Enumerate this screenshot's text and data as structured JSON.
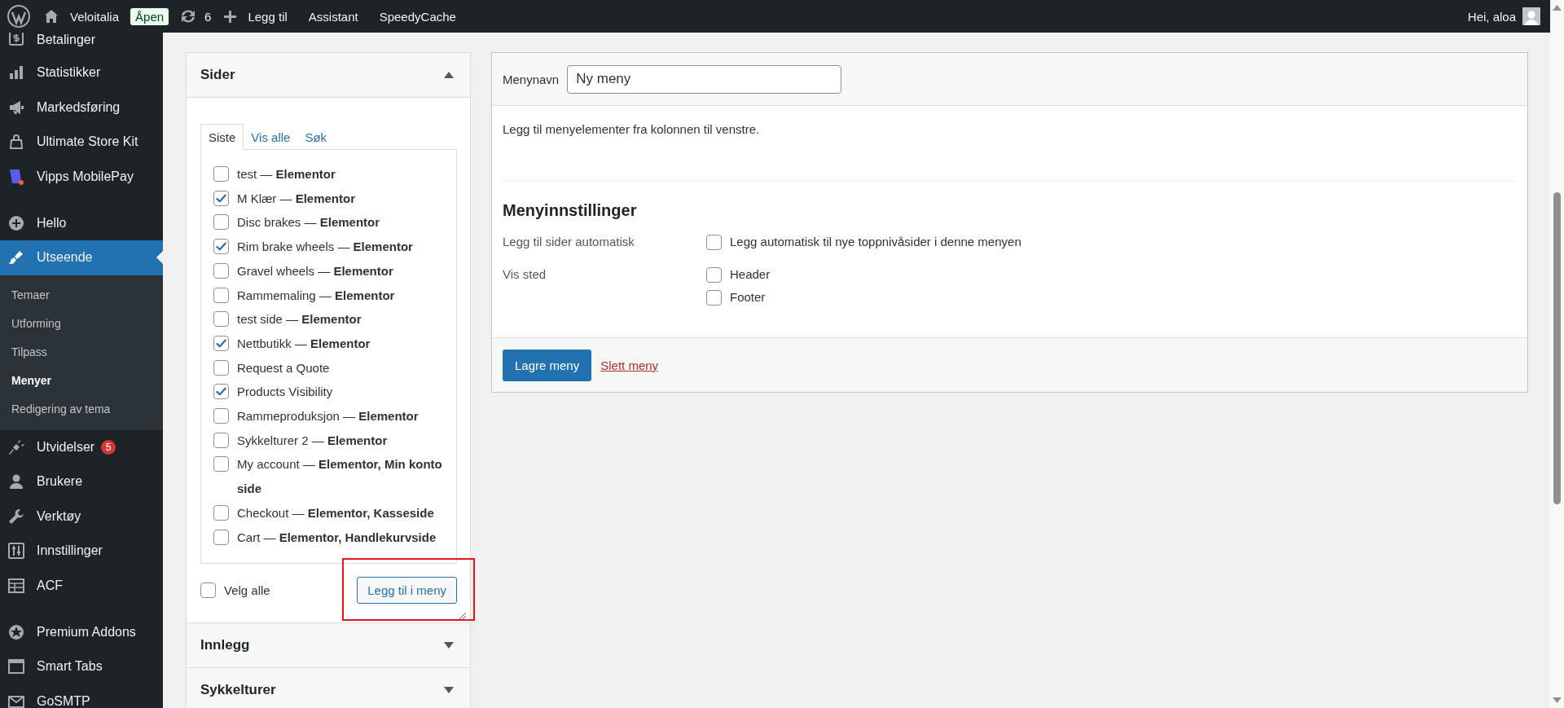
{
  "admin_bar": {
    "site_name": "Veloitalia",
    "status_badge": "Åpen",
    "updates_count": "6",
    "new_label": "Legg til",
    "links": [
      "Assistant",
      "SpeedyCache"
    ],
    "greeting": "Hei, aloa"
  },
  "sidebar": {
    "groups": [
      {
        "items": [
          {
            "label": "Betalinger",
            "selected": false
          },
          {
            "label": "Statistikker",
            "selected": false
          },
          {
            "label": "Markedsføring",
            "selected": false
          },
          {
            "label": "Ultimate Store Kit",
            "selected": false
          },
          {
            "label": "Vipps MobilePay",
            "selected": false
          }
        ]
      },
      {
        "items": [
          {
            "label": "Hello",
            "selected": false
          },
          {
            "label": "Utseende",
            "selected": true,
            "children": [
              {
                "label": "Temaer",
                "selected": false
              },
              {
                "label": "Utforming",
                "selected": false
              },
              {
                "label": "Tilpass",
                "selected": false
              },
              {
                "label": "Menyer",
                "selected": true
              },
              {
                "label": "Redigering av tema",
                "selected": false
              }
            ]
          },
          {
            "label": "Utvidelser",
            "selected": false,
            "badge": "5"
          },
          {
            "label": "Brukere",
            "selected": false
          },
          {
            "label": "Verktøy",
            "selected": false
          },
          {
            "label": "Innstillinger",
            "selected": false
          },
          {
            "label": "ACF",
            "selected": false
          }
        ]
      },
      {
        "items": [
          {
            "label": "Premium Addons",
            "selected": false
          },
          {
            "label": "Smart Tabs",
            "selected": false
          },
          {
            "label": "GoSMTP",
            "selected": false
          }
        ]
      }
    ]
  },
  "add_items": {
    "sections": [
      {
        "title": "Sider",
        "expanded": true,
        "tabs": [
          {
            "label": "Siste",
            "selected": true
          },
          {
            "label": "Vis alle",
            "selected": false
          },
          {
            "label": "Søk",
            "selected": false
          }
        ],
        "items": [
          {
            "label": "test — **Elementor**",
            "checked": false
          },
          {
            "label": "M Klær — **Elementor**",
            "checked": true
          },
          {
            "label": "Disc brakes — **Elementor**",
            "checked": false
          },
          {
            "label": "Rim brake wheels — **Elementor**",
            "checked": true
          },
          {
            "label": "Gravel wheels — **Elementor**",
            "checked": false
          },
          {
            "label": "Rammemaling — **Elementor**",
            "checked": false
          },
          {
            "label": "test side — **Elementor**",
            "checked": false
          },
          {
            "label": "Nettbutikk — **Elementor**",
            "checked": true
          },
          {
            "label": "Request a Quote",
            "checked": false
          },
          {
            "label": "Products Visibility",
            "checked": true
          },
          {
            "label": "Rammeproduksjon — **Elementor**",
            "checked": false
          },
          {
            "label": "Sykkelturer 2 — **Elementor**",
            "checked": false
          },
          {
            "label": "My account — **Elementor, Min konto side**",
            "checked": false
          },
          {
            "label": "Checkout — **Elementor, Kasseside**",
            "checked": false
          },
          {
            "label": "Cart — **Elementor, Handlekurvside**",
            "checked": false
          }
        ],
        "select_all": {
          "label": "Velg alle",
          "checked": false
        },
        "add_button": "Legg til i meny"
      },
      {
        "title": "Innlegg",
        "expanded": false
      },
      {
        "title": "Sykkelturer",
        "expanded": false
      }
    ]
  },
  "menu_structure": {
    "name_label": "Menynavn",
    "name_value": "Ny meny",
    "instructions": "Legg til menyelementer fra kolonnen til venstre.",
    "settings": {
      "heading": "Menyinnstillinger",
      "rows": [
        {
          "label": "Legg til sider automatisk",
          "options": [
            {
              "label": "Legg automatisk til nye toppnivåsider i denne menyen",
              "checked": false
            }
          ]
        },
        {
          "label": "Vis sted",
          "options": [
            {
              "label": "Header",
              "checked": false
            },
            {
              "label": "Footer",
              "checked": false
            }
          ]
        }
      ]
    },
    "save_button": "Lagre meny",
    "delete_link": "Slett meny"
  }
}
